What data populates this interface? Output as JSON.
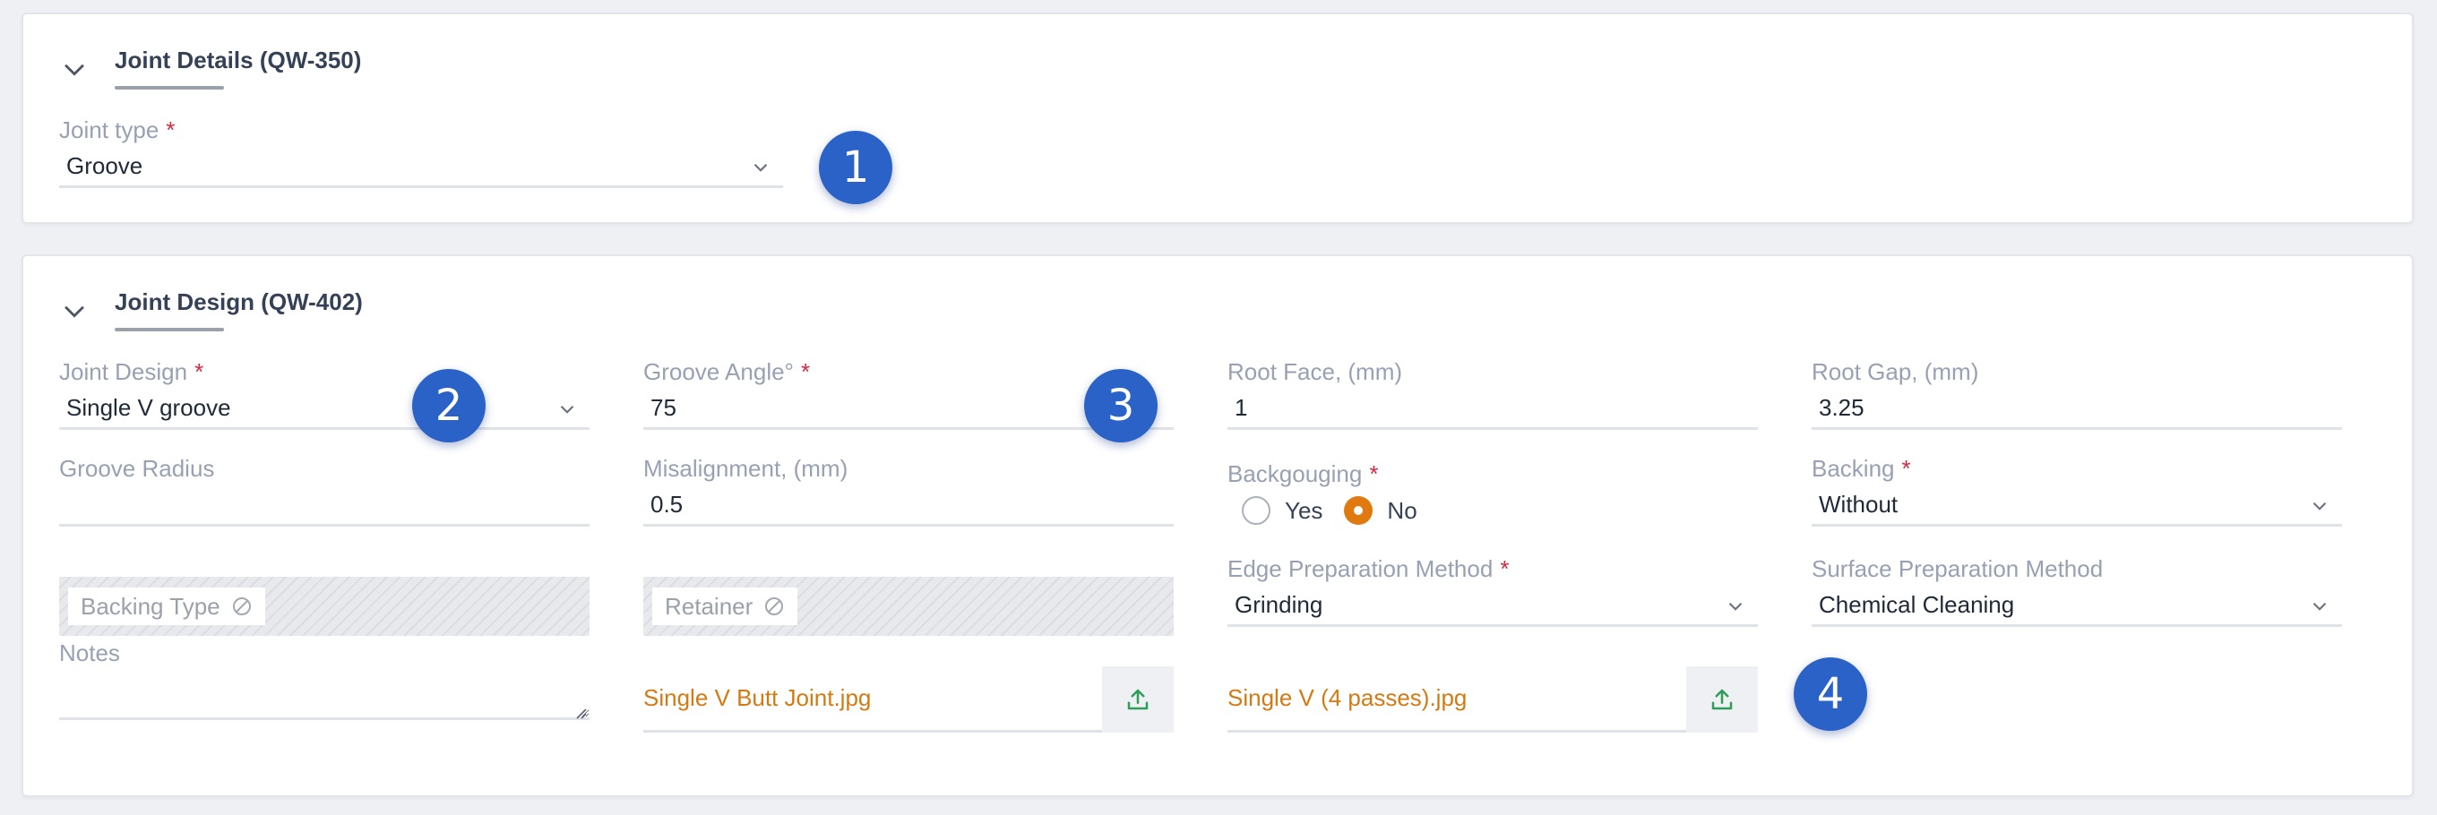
{
  "section1": {
    "title": "Joint Details (QW-350)",
    "joint_type": {
      "label": "Joint type",
      "required": "*",
      "value": "Groove"
    },
    "badge": "1"
  },
  "section2": {
    "title": "Joint Design (QW-402)",
    "joint_design": {
      "label": "Joint Design",
      "required": "*",
      "value": "Single V groove"
    },
    "groove_angle": {
      "label": "Groove Angle°",
      "required": "*",
      "value": "75"
    },
    "root_face": {
      "label": "Root Face, (mm)",
      "value": "1"
    },
    "root_gap": {
      "label": "Root Gap, (mm)",
      "value": "3.25"
    },
    "groove_radius": {
      "label": "Groove Radius",
      "value": ""
    },
    "misalignment": {
      "label": "Misalignment, (mm)",
      "value": "0.5"
    },
    "backgouging": {
      "label": "Backgouging",
      "required": "*",
      "options": [
        "Yes",
        "No"
      ],
      "selected": "No"
    },
    "backing": {
      "label": "Backing",
      "required": "*",
      "value": "Without"
    },
    "backing_type": {
      "label": "Backing Type"
    },
    "retainer": {
      "label": "Retainer"
    },
    "edge_prep": {
      "label": "Edge Preparation Method",
      "required": "*",
      "value": "Grinding"
    },
    "surface_prep": {
      "label": "Surface Preparation Method",
      "value": "Chemical Cleaning"
    },
    "notes": {
      "label": "Notes",
      "value": ""
    },
    "file1": "Single V Butt Joint.jpg",
    "file2": "Single V (4 passes).jpg",
    "badges": [
      "2",
      "3",
      "4"
    ]
  },
  "icons": {
    "collapse": "chevron-down-icon",
    "select": "chevron-down-icon",
    "upload": "upload-icon",
    "disabled": "ban-icon"
  },
  "colors": {
    "badge": "#2b62c8",
    "required": "#d6293e",
    "file_link": "#d47a12",
    "upload_icon": "#2e9e5b",
    "radio_selected": "#e07a10"
  }
}
